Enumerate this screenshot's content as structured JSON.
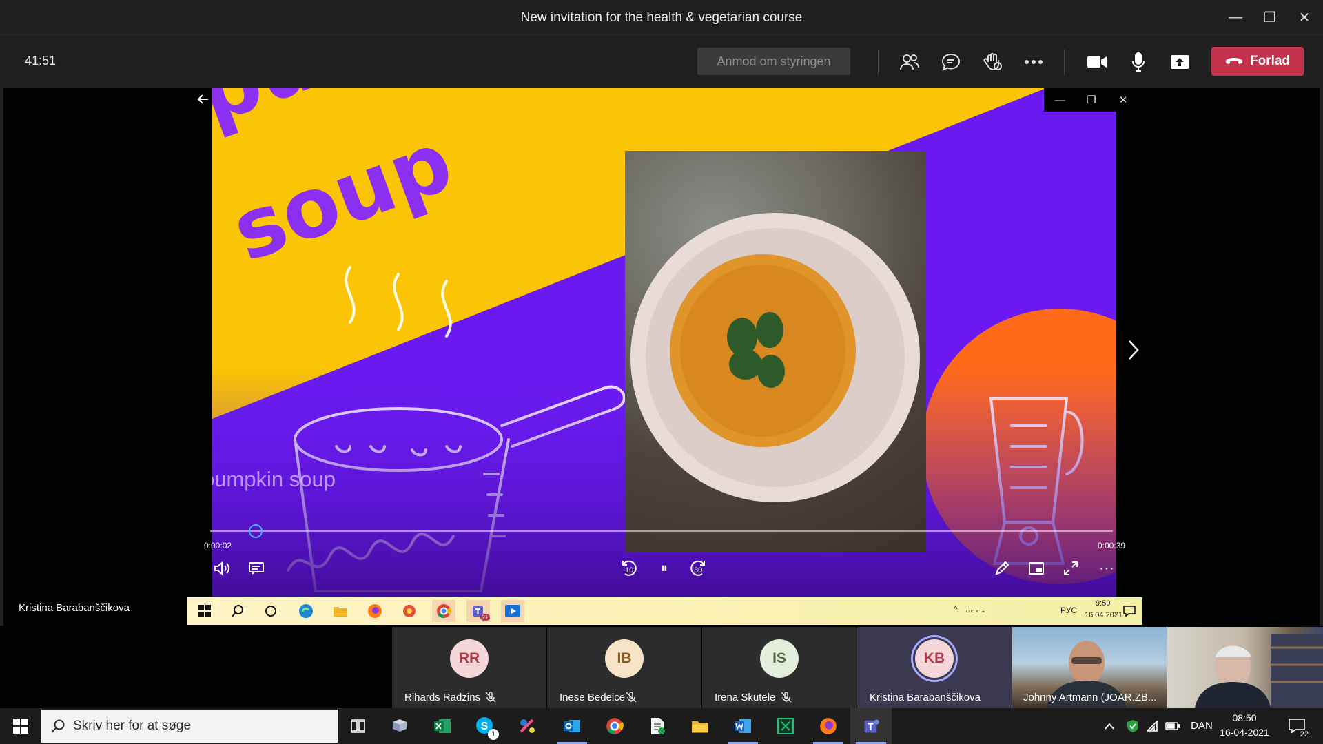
{
  "window": {
    "title": "New invitation for the health & vegetarian course",
    "minimize_glyph": "—",
    "restore_glyph": "❐",
    "close_glyph": "✕"
  },
  "meeting": {
    "timer": "41:51",
    "request_control_label": "Anmod om styringen",
    "leave_label": "Forlad",
    "icons": [
      "participants-icon",
      "chat-icon",
      "raise-hand-icon",
      "more-actions-icon",
      "camera-icon",
      "microphone-icon",
      "share-screen-icon",
      "hang-up-icon"
    ]
  },
  "stage": {
    "presenter_name": "Kristina Barabanščikova",
    "slide": {
      "title_line1": "pumpkin",
      "title_line2": "soup",
      "caption": "pumpkin soup",
      "colors": {
        "yellow": "#fbc404",
        "purple": "#6a1af0",
        "orange": "#ff6a1a",
        "title": "#8b2ff2"
      }
    },
    "player": {
      "elapsed": "0:00:02",
      "total": "0:00:39",
      "progress": 0.05,
      "skip_back_label": "10",
      "skip_forward_label": "30",
      "pause_glyph": "⏸",
      "more_glyph": "⋯"
    },
    "inner_taskbar": {
      "lang": "РУС",
      "time": "9:50",
      "date": "16.04.2021",
      "teams_badge": "9+"
    }
  },
  "participants": [
    {
      "initials": "RR",
      "name": "Rihards Radzins",
      "avatar_bg": "#f5d7da",
      "avatar_fg": "#b23a4b",
      "muted": true
    },
    {
      "initials": "IB",
      "name": "Inese Bedeice",
      "avatar_bg": "#f7e4c8",
      "avatar_fg": "#8a5a1c",
      "muted": true
    },
    {
      "initials": "IS",
      "name": "Irēna Skutele",
      "avatar_bg": "#e4eedd",
      "avatar_fg": "#4d6b3a",
      "muted": true
    },
    {
      "initials": "KB",
      "name": "Kristina Barabanščikova",
      "avatar_bg": "#f5d7da",
      "avatar_fg": "#b23a4b",
      "muted": false,
      "speaking": true
    }
  ],
  "video_participants": [
    {
      "name": "Johnny Artmann (JOAR.ZB..."
    }
  ],
  "taskbar": {
    "search_placeholder": "Skriv her for at søge",
    "skype_badge": "1",
    "lang": "DAN",
    "time": "08:50",
    "date": "16-04-2021",
    "notifications": "22"
  }
}
